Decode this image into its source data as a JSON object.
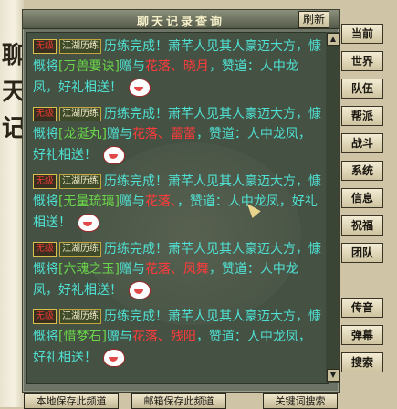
{
  "window": {
    "title": "聊天记录查询",
    "refresh_label": "刷新"
  },
  "left_scroll": {
    "glyphs": [
      "聊",
      "天",
      "记"
    ]
  },
  "messages": [
    {
      "tag_red": "无级",
      "tag_green": "江湖历练",
      "text_a": "历练完成！萧芊人见其人豪迈大方，慷慨将",
      "item": "[万兽要诀]",
      "text_b": "赠与",
      "name": "花落、晓月",
      "text_c": "，赞道：人中龙凤，好礼相送！"
    },
    {
      "tag_red": "无级",
      "tag_green": "江湖历练",
      "text_a": "历练完成！萧芊人见其人豪迈大方，慷慨将",
      "item": "[龙涎丸]",
      "text_b": "赠与",
      "name": "花落、蕾蕾",
      "text_c": "，赞道：人中龙凤，好礼相送！"
    },
    {
      "tag_red": "无级",
      "tag_green": "江湖历练",
      "text_a": "历练完成！萧芊人见其人豪迈大方，慷慨将",
      "item": "[无量琉璃]",
      "text_b": "赠与",
      "name": "花落、",
      "text_c": "，赞道：人中龙凤，好礼相送！"
    },
    {
      "tag_red": "无级",
      "tag_green": "江湖历练",
      "text_a": "历练完成！萧芊人见其人豪迈大方，慷慨将",
      "item": "[六魂之玉]",
      "text_b": "赠与",
      "name": "花落、凤舞",
      "text_c": "，赞道：人中龙凤，好礼相送！"
    },
    {
      "tag_red": "无级",
      "tag_green": "江湖历练",
      "text_a": "历练完成！萧芊人见其人豪迈大方，慷慨将",
      "item": "[惜梦石]",
      "text_b": "赠与",
      "name": "花落、残阳",
      "text_c": "，赞道：人中龙凤，好礼相送！"
    }
  ],
  "side_buttons": [
    "当前",
    "世界",
    "队伍",
    "帮派",
    "战斗",
    "系统",
    "信息",
    "祝福",
    "团队",
    "传音",
    "弹幕",
    "搜索"
  ],
  "bottom_buttons": {
    "save_local": "本地保存此频道",
    "save_mail": "邮箱保存此频道",
    "keyword_search": "关键词搜索"
  },
  "colors": {
    "text_cyan": "#4fe1d3",
    "item_green": "#6bd64a",
    "name_red": "#ff3b3b",
    "tag_red": "#e53b2f"
  }
}
